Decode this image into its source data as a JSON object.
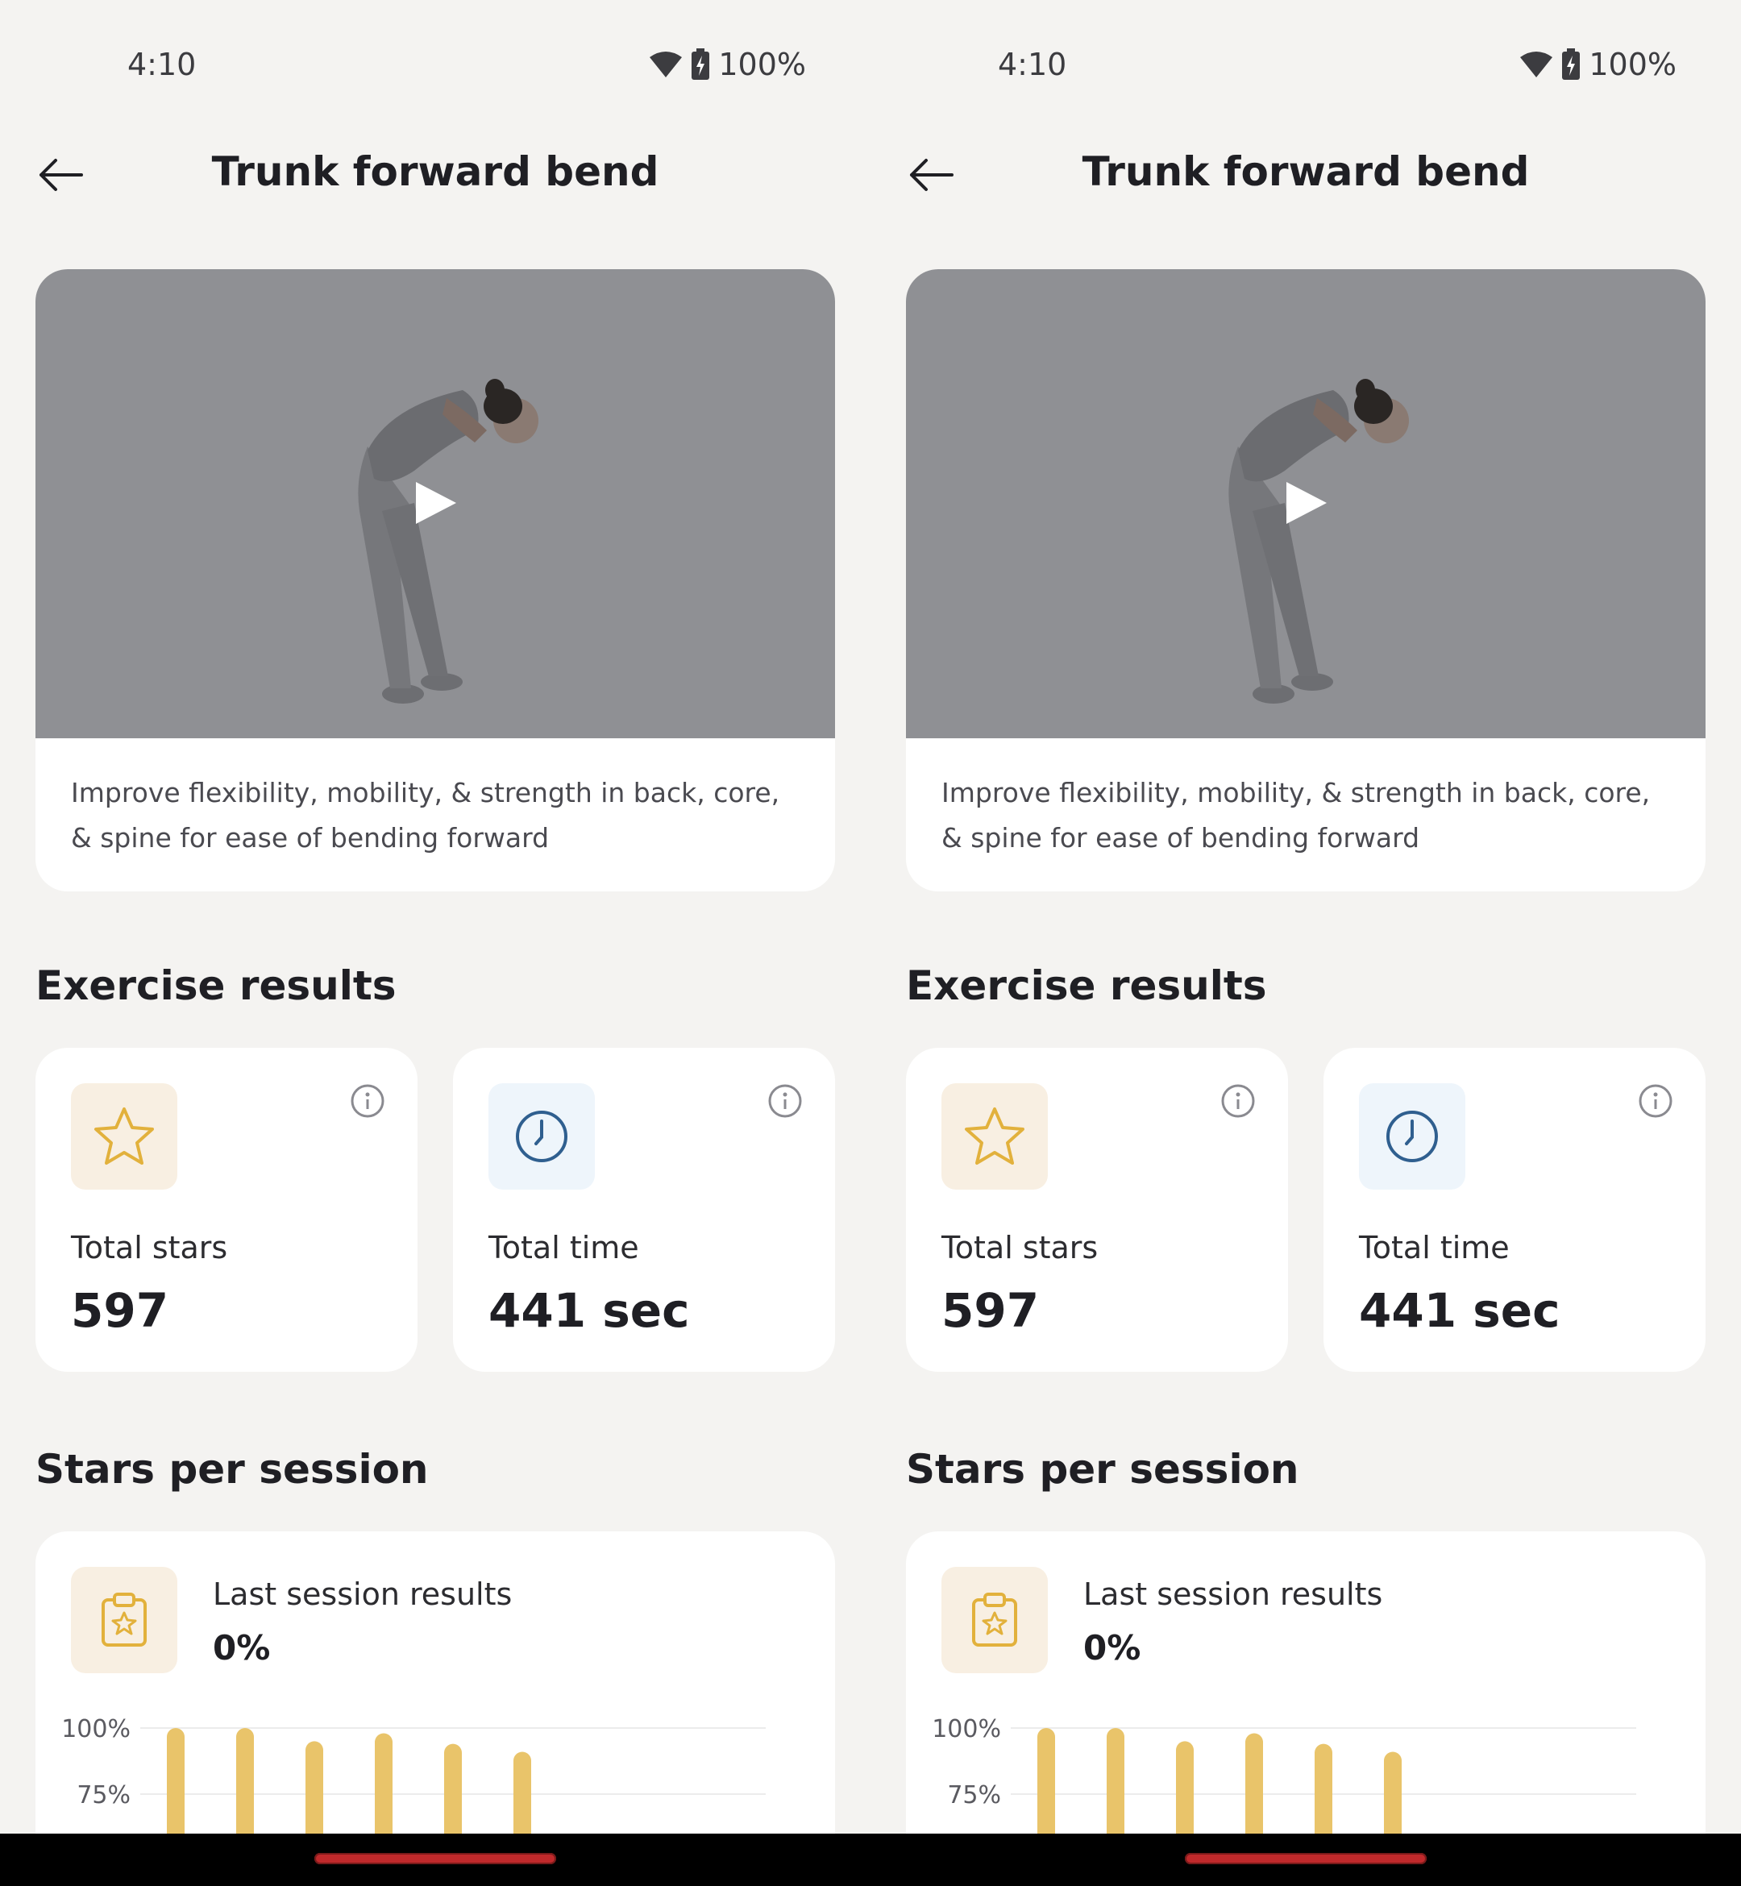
{
  "screens": [
    {
      "status": {
        "time": "4:10",
        "battery": "100%"
      },
      "header": {
        "title": "Trunk forward bend"
      },
      "video": {
        "description": "Improve flexibility, mobility, & strength in back, core, & spine for ease of bending forward"
      },
      "results": {
        "title": "Exercise results",
        "stars": {
          "label": "Total stars",
          "value": "597",
          "icon": "star-icon"
        },
        "time": {
          "label": "Total time",
          "value": "441 sec",
          "icon": "clock-icon"
        }
      },
      "session": {
        "title": "Stars per session",
        "label": "Last session results",
        "value": "0%",
        "icon": "clipboard-star-icon"
      }
    },
    {
      "status": {
        "time": "4:10",
        "battery": "100%"
      },
      "header": {
        "title": "Trunk forward bend"
      },
      "video": {
        "description": "Improve flexibility, mobility, & strength in back, core, & spine for ease of bending forward"
      },
      "results": {
        "title": "Exercise results",
        "stars": {
          "label": "Total stars",
          "value": "597",
          "icon": "star-icon"
        },
        "time": {
          "label": "Total time",
          "value": "441 sec",
          "icon": "clock-icon"
        }
      },
      "session": {
        "title": "Stars per session",
        "label": "Last session results",
        "value": "0%",
        "icon": "clipboard-star-icon"
      }
    }
  ],
  "chart_data": {
    "type": "bar",
    "y_tick_labels": [
      "100%",
      "75%"
    ],
    "values": [
      100,
      100,
      95,
      98,
      94,
      91
    ],
    "color": "#e9c46a"
  },
  "colors": {
    "background": "#f4f3f1",
    "star_accent": "#e2b13c",
    "star_box": "#f8efe2",
    "clock_accent": "#2f5f8f",
    "clock_box": "#eef5fb",
    "video_bg": "#8f9094"
  }
}
